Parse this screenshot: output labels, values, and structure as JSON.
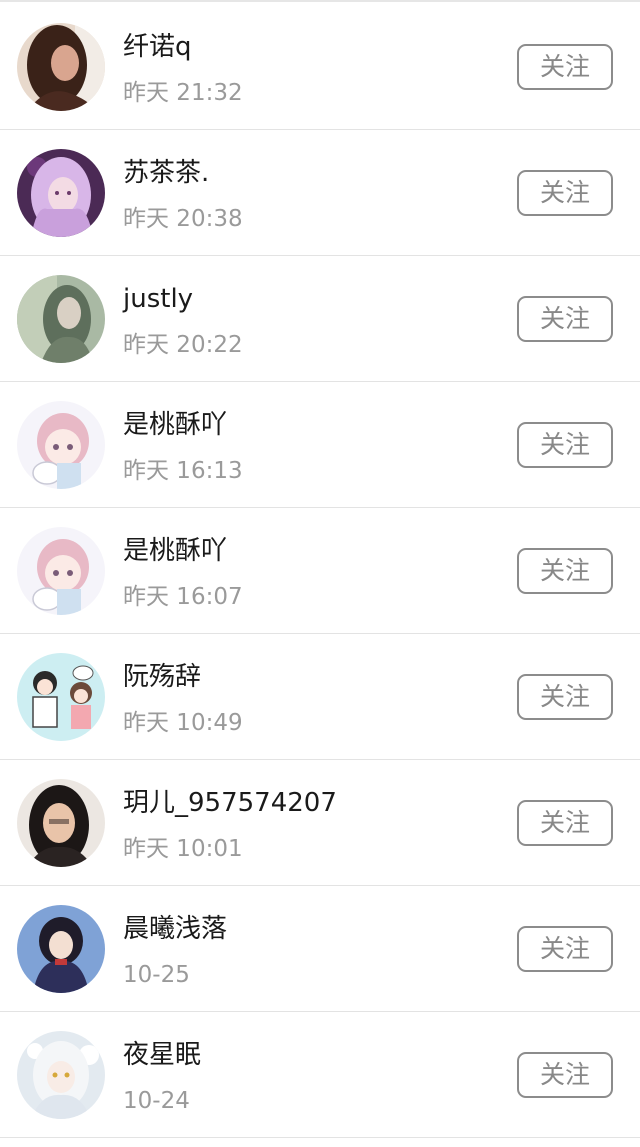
{
  "follow_list": {
    "items": [
      {
        "name": "纤诺q",
        "time": "昨天 21:32",
        "follow_label": "关注",
        "avatar": "avatar-photo-woman-long-dark-hair"
      },
      {
        "name": "苏茶茶.",
        "time": "昨天 20:38",
        "follow_label": "关注",
        "avatar": "avatar-illustration-pink-hair-girl"
      },
      {
        "name": "justly",
        "time": "昨天 20:22",
        "follow_label": "关注",
        "avatar": "avatar-photo-girl-green-tint"
      },
      {
        "name": "是桃酥吖",
        "time": "昨天 16:13",
        "follow_label": "关注",
        "avatar": "avatar-cartoon-girl-with-cat"
      },
      {
        "name": "是桃酥吖",
        "time": "昨天 16:07",
        "follow_label": "关注",
        "avatar": "avatar-cartoon-girl-with-cat"
      },
      {
        "name": "阮殇辞",
        "time": "昨天 10:49",
        "follow_label": "关注",
        "avatar": "avatar-cartoon-couple"
      },
      {
        "name": "玥儿_957574207",
        "time": "昨天 10:01",
        "follow_label": "关注",
        "avatar": "avatar-photo-girl-glasses"
      },
      {
        "name": "晨曦浅落",
        "time": "10-25",
        "follow_label": "关注",
        "avatar": "avatar-anime-girl-dark-hair"
      },
      {
        "name": "夜星眠",
        "time": "10-24",
        "follow_label": "关注",
        "avatar": "avatar-illustration-white-hair-girl"
      }
    ]
  },
  "colors": {
    "name_text": "#1a1a1a",
    "time_text": "#9a9a9a",
    "button_border": "#8c8c8c",
    "button_text": "#888888",
    "divider": "#e3e3e3",
    "background": "#ffffff"
  }
}
